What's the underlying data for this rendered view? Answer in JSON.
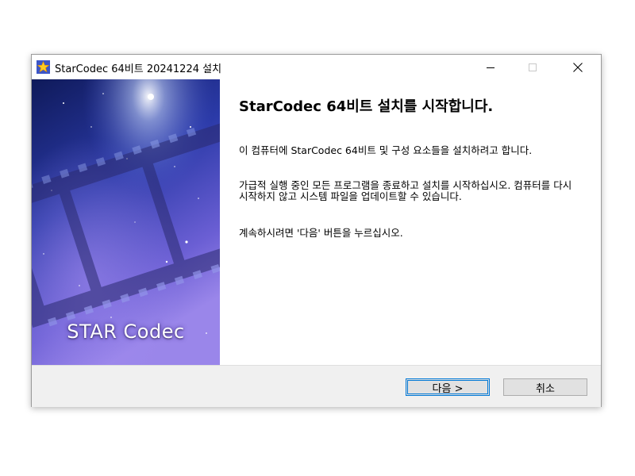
{
  "window": {
    "title": "StarCodec 64비트 20241224 설치",
    "icon": "starcodec-star-icon"
  },
  "banner": {
    "brand_text": "STAR Codec"
  },
  "content": {
    "heading": "StarCodec 64비트 설치를 시작합니다.",
    "paragraphs": [
      "이 컴퓨터에 StarCodec 64비트 및 구성 요소들을 설치하려고 합니다.",
      "가급적 실행 중인 모든 프로그램을 종료하고 설치를 시작하십시오. 컴퓨터를 다시 시작하지 않고 시스템 파일을 업데이트할 수 있습니다.",
      "계속하시려면 '다음' 버튼을 누르십시오."
    ]
  },
  "buttons": {
    "next": "다음 >",
    "cancel": "취소"
  },
  "colors": {
    "accent": "#0078d7",
    "footer_bg": "#f0f0f0",
    "banner_dark": "#1d2a8a",
    "banner_light": "#8a78e0"
  }
}
